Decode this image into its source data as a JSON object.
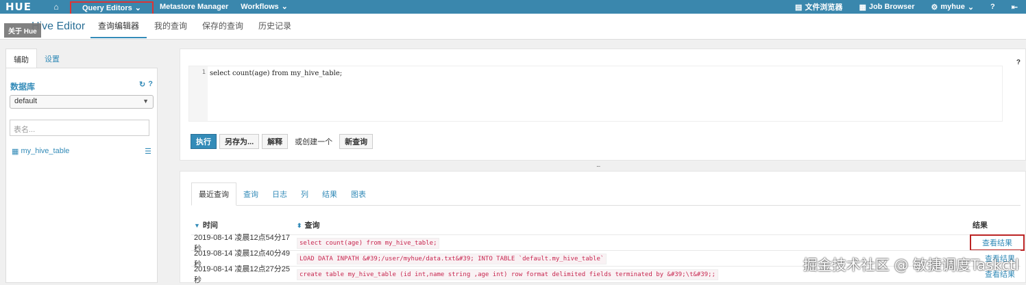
{
  "topbar": {
    "logo": "HUE",
    "nav": [
      "Query Editors",
      "Metastore Manager",
      "Workflows"
    ],
    "right": [
      "文件浏览器",
      "Job Browser",
      "myhue"
    ],
    "help": "?",
    "colors": {
      "bar": "#3a87ad",
      "highlight": "#d33"
    }
  },
  "subbar": {
    "tooltip": "关于 Hue",
    "title": "Hive Editor",
    "tabs": [
      "查询编辑器",
      "我的查询",
      "保存的查询",
      "历史记录"
    ]
  },
  "left": {
    "tabs": [
      "辅助",
      "设置"
    ],
    "db_label": "数据库",
    "db_selected": "default",
    "table_placeholder": "表名...",
    "tables": [
      "my_hive_table"
    ]
  },
  "editor": {
    "line_number": "1",
    "query": "select count(age) from my_hive_table;",
    "help": "?",
    "buttons": {
      "execute": "执行",
      "save_as": "另存为...",
      "explain": "解释",
      "or_create": "或创建一个",
      "new_query": "新查询"
    }
  },
  "splitter": "...",
  "results": {
    "tabs": [
      "最近查询",
      "查询",
      "日志",
      "列",
      "结果",
      "图表"
    ],
    "headers": {
      "time": "时间",
      "query": "查询",
      "result": "结果"
    },
    "rows": [
      {
        "time": "2019-08-14 凌晨12点54分17秒",
        "query": "select count(age) from my_hive_table;",
        "result": "查看结果"
      },
      {
        "time": "2019-08-14 凌晨12点40分49秒",
        "query": "LOAD DATA INPATH &#39;/user/myhue/data.txt&#39; INTO TABLE `default.my_hive_table`",
        "result": "查看结果"
      },
      {
        "time": "2019-08-14 凌晨12点27分25秒",
        "query": "create table my_hive_table (id int,name string ,age int) row format delimited fields terminated by &#39;\\t&#39;;",
        "result": "查看结果"
      }
    ]
  },
  "watermark": "掘金技术社区 @ 敏捷调度Taskctl"
}
